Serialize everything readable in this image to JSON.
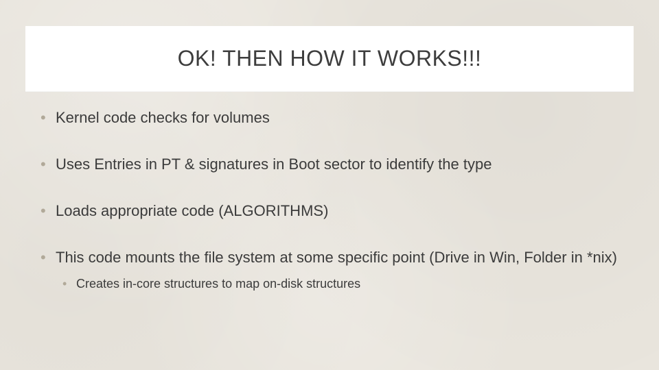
{
  "title": "OK! THEN HOW IT WORKS!!!",
  "bullets": [
    {
      "text": "Kernel code checks for volumes"
    },
    {
      "text": "Uses Entries in PT & signatures in Boot sector to identify the type"
    },
    {
      "text": "Loads appropriate code (ALGORITHMS)"
    },
    {
      "text": "This code mounts the file system at some specific point (Drive in Win, Folder in *nix)",
      "sub": [
        {
          "text": "Creates in-core structures to map on-disk structures"
        }
      ]
    }
  ]
}
